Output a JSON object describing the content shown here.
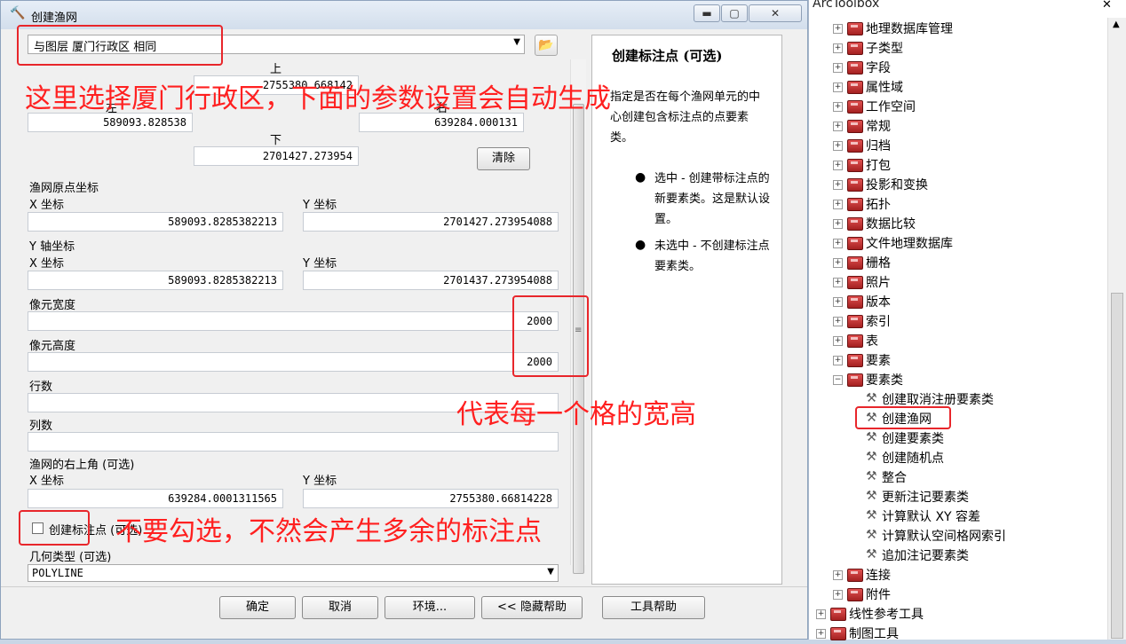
{
  "dialog": {
    "title": "创建渔网",
    "controls": {
      "minimize": "▬",
      "maximize": "▢",
      "close": "✕"
    },
    "template": {
      "value": "与图层  厦门行政区  相同"
    },
    "extent": {
      "top_label": "上",
      "top_value": "2755380.668142",
      "left_label": "左",
      "left_value": "589093.828538",
      "right_label": "右",
      "right_value": "639284.000131",
      "bottom_label": "下",
      "bottom_value": "2701427.273954",
      "clear_button": "清除"
    },
    "origin": {
      "title": "渔网原点坐标",
      "x_label": "X 坐标",
      "x_value": "589093.8285382213",
      "y_label": "Y 坐标",
      "y_value": "2701427.273954088"
    },
    "yaxis": {
      "title": "Y 轴坐标",
      "x_label": "X 坐标",
      "x_value": "589093.8285382213",
      "y_label": "Y 坐标",
      "y_value": "2701437.273954088"
    },
    "cell_width": {
      "label": "像元宽度",
      "value": "2000"
    },
    "cell_height": {
      "label": "像元高度",
      "value": "2000"
    },
    "rows": {
      "label": "行数",
      "value": ""
    },
    "cols": {
      "label": "列数",
      "value": ""
    },
    "corner": {
      "title": "渔网的右上角 (可选)",
      "x_label": "X 坐标",
      "x_value": "639284.0001311565",
      "y_label": "Y 坐标",
      "y_value": "2755380.66814228"
    },
    "label_points": {
      "label": "创建标注点 (可选)",
      "checked": false
    },
    "geometry": {
      "label": "几何类型 (可选)",
      "value": "POLYLINE"
    },
    "buttons": {
      "ok": "确定",
      "cancel": "取消",
      "env": "环境...",
      "hide_help": "<< 隐藏帮助",
      "tool_help": "工具帮助"
    }
  },
  "help": {
    "title": "创建标注点 (可选)",
    "desc": "指定是否在每个渔网单元的中心创建包含标注点的点要素类。",
    "bullet1": "选中 - 创建带标注点的新要素类。这是默认设置。",
    "bullet2": "未选中 - 不创建标注点要素类。"
  },
  "annotations": {
    "a1": "这里选择厦门行政区，下面的参数设置会自动生成",
    "a2": "代表每一个格的宽高",
    "a3": "不要勾选，不然会产生多余的标注点"
  },
  "toolbox": {
    "title": "ArcToolbox",
    "items": [
      "地理数据库管理",
      "子类型",
      "字段",
      "属性域",
      "工作空间",
      "常规",
      "归档",
      "打包",
      "投影和变换",
      "拓扑",
      "数据比较",
      "文件地理数据库",
      "栅格",
      "照片",
      "版本",
      "索引",
      "表",
      "要素",
      "要素类"
    ],
    "tools": [
      "创建取消注册要素类",
      "创建渔网",
      "创建要素类",
      "创建随机点",
      "整合",
      "更新注记要素类",
      "计算默认 XY 容差",
      "计算默认空间格网索引",
      "追加注记要素类"
    ],
    "after": [
      "连接",
      "附件"
    ],
    "top": [
      "线性参考工具",
      "制图工具"
    ]
  },
  "colors": {
    "annotation": "#ff2020",
    "toolbox_icon": "#c03030"
  }
}
